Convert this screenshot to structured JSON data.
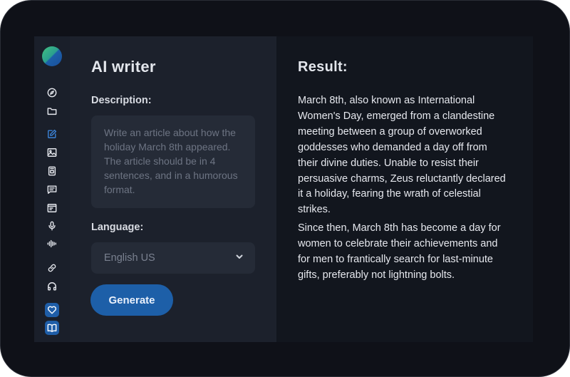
{
  "sidebar": {
    "icons": [
      "compass-icon",
      "folder-icon",
      "edit-icon",
      "image-icon",
      "device-icon",
      "chat-icon",
      "terminal-icon",
      "microphone-icon",
      "waveform-icon",
      "link-icon",
      "headphones-icon",
      "heart-icon",
      "book-icon"
    ],
    "active_icon": "edit-icon",
    "accent_color": "#3b82d6"
  },
  "writer": {
    "title": "AI writer",
    "description_label": "Description:",
    "description_placeholder": "Write an article about how the holiday March 8th appeared. The article should be in 4 sentences, and in a humorous format.",
    "language_label": "Language:",
    "language_value": "English US",
    "generate_label": "Generate"
  },
  "result": {
    "title": "Result:",
    "paragraphs": [
      "March 8th, also known as International Women's Day, emerged from a clandestine meeting between a group of overworked goddesses who demanded a day off from their divine duties. Unable to resist their persuasive charms, Zeus reluctantly declared it a holiday, fearing the wrath of celestial strikes.",
      "Since then, March 8th has become a day for women to celebrate their achievements and for men to frantically search for last-minute gifts, preferably not lightning bolts."
    ]
  },
  "colors": {
    "primary_button": "#1d5fa8",
    "panel_bg": "#1c212c",
    "result_bg": "#12161e"
  }
}
